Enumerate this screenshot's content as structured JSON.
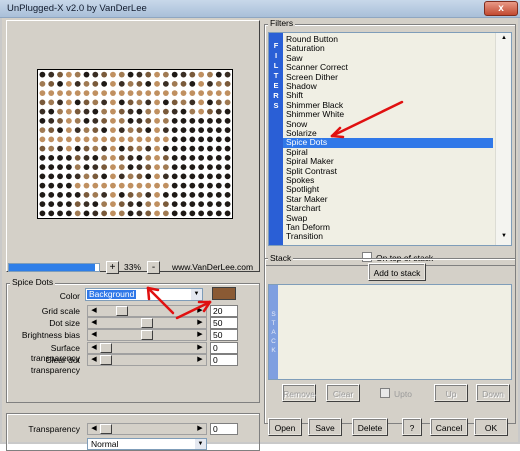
{
  "window": {
    "title": "UnPlugged-X v2.0 by VanDerLee",
    "close_glyph": "x"
  },
  "preview": {
    "zoom_value": "33%",
    "zoom_fraction": 0.95,
    "zoom_minus": "-",
    "zoom_plus": "+",
    "website": "www.VanDerLee.com",
    "dot_colors": [
      "#1f1a16",
      "#7a5a3a",
      "#a07a52",
      "#3a2e24",
      "#c09060"
    ]
  },
  "spice_dots": {
    "group_title": "Spice Dots",
    "color": {
      "label": "Color",
      "value": "Background",
      "swatch": "#8a5a34"
    },
    "sliders": [
      {
        "label": "Grid scale",
        "value": "20",
        "level": 0.2
      },
      {
        "label": "Dot size",
        "value": "50",
        "level": 0.5
      },
      {
        "label": "Brightness bias",
        "value": "50",
        "level": 0.5
      },
      {
        "label": "Surface transparency",
        "value": "0",
        "level": 0
      },
      {
        "label": "Clear dot transparency",
        "value": "0",
        "level": 0
      }
    ]
  },
  "blend": {
    "transparency_label": "Transparency",
    "transparency_value": "0",
    "mode": "Normal"
  },
  "filters": {
    "group_title": "Filters",
    "strip_letters": [
      "F",
      "I",
      "L",
      "T",
      "E",
      "R",
      "S"
    ],
    "items": [
      "Round Button",
      "Saturation",
      "Saw",
      "Scanner Correct",
      "Screen Dither",
      "Shadow",
      "Shift",
      "Shimmer Black",
      "Shimmer White",
      "Snow",
      "Solarize",
      "Spice Dots",
      "Spiral",
      "Spiral Maker",
      "Split Contrast",
      "Spokes",
      "Spotlight",
      "Star Maker",
      "Starchart",
      "Swap",
      "Tan Deform",
      "Transition"
    ],
    "selected_index": 11,
    "on_top_label": "On top of stack",
    "annotation_color": "#e01010"
  },
  "stack": {
    "group_title": "Stack",
    "strip_letters": [
      "S",
      "T",
      "A",
      "C",
      "K"
    ],
    "add_button": "Add to stack",
    "remove": "Remove",
    "clear": "Clear",
    "upto": "Upto",
    "up": "Up",
    "down": "Down"
  },
  "footer": {
    "open": "Open",
    "save": "Save",
    "delete": "Delete",
    "help": "?",
    "cancel": "Cancel",
    "ok": "OK"
  }
}
